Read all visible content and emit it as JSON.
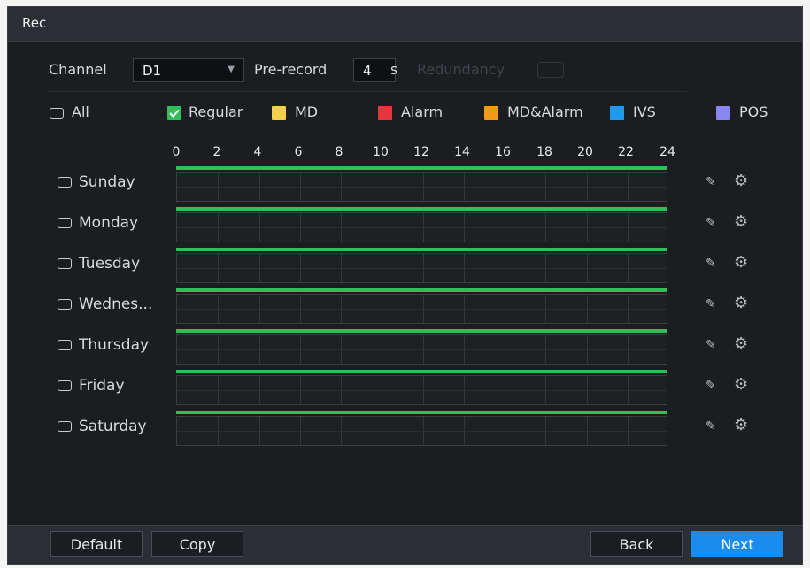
{
  "window": {
    "title": "Rec"
  },
  "settings": {
    "channel_label": "Channel",
    "channel_value": "D1",
    "prerecord_label": "Pre-record",
    "prerecord_value": "4",
    "prerecord_unit": "s",
    "redundancy_label": "Redundancy"
  },
  "legend": {
    "all_label": "All",
    "items": [
      {
        "label": "Regular",
        "color": "#2fbf5a"
      },
      {
        "label": "MD",
        "color": "#f2d04a"
      },
      {
        "label": "Alarm",
        "color": "#e8363f"
      },
      {
        "label": "MD&Alarm",
        "color": "#f39a1c"
      },
      {
        "label": "IVS",
        "color": "#1e9bf0"
      },
      {
        "label": "POS",
        "color": "#8a86f0"
      }
    ]
  },
  "timeline": {
    "ticks": [
      "0",
      "2",
      "4",
      "6",
      "8",
      "10",
      "12",
      "14",
      "16",
      "18",
      "20",
      "22",
      "24"
    ],
    "hours_total": 24
  },
  "schedule": [
    {
      "day": "Sunday",
      "segments": [
        {
          "start": 0,
          "end": 24,
          "type": "Regular"
        }
      ]
    },
    {
      "day": "Monday",
      "segments": [
        {
          "start": 0,
          "end": 24,
          "type": "Regular"
        }
      ]
    },
    {
      "day": "Tuesday",
      "segments": [
        {
          "start": 0,
          "end": 24,
          "type": "Regular"
        }
      ]
    },
    {
      "day": "Wednes...",
      "segments": [
        {
          "start": 0,
          "end": 24,
          "type": "Regular"
        }
      ]
    },
    {
      "day": "Thursday",
      "segments": [
        {
          "start": 0,
          "end": 24,
          "type": "Regular"
        }
      ]
    },
    {
      "day": "Friday",
      "segments": [
        {
          "start": 0,
          "end": 24,
          "type": "Regular"
        }
      ]
    },
    {
      "day": "Saturday",
      "segments": [
        {
          "start": 0,
          "end": 24,
          "type": "Regular"
        }
      ]
    }
  ],
  "row_icons": {
    "edit": "pencil-icon",
    "settings": "gear-icon"
  },
  "footer": {
    "default_label": "Default",
    "copy_label": "Copy",
    "back_label": "Back",
    "next_label": "Next"
  }
}
